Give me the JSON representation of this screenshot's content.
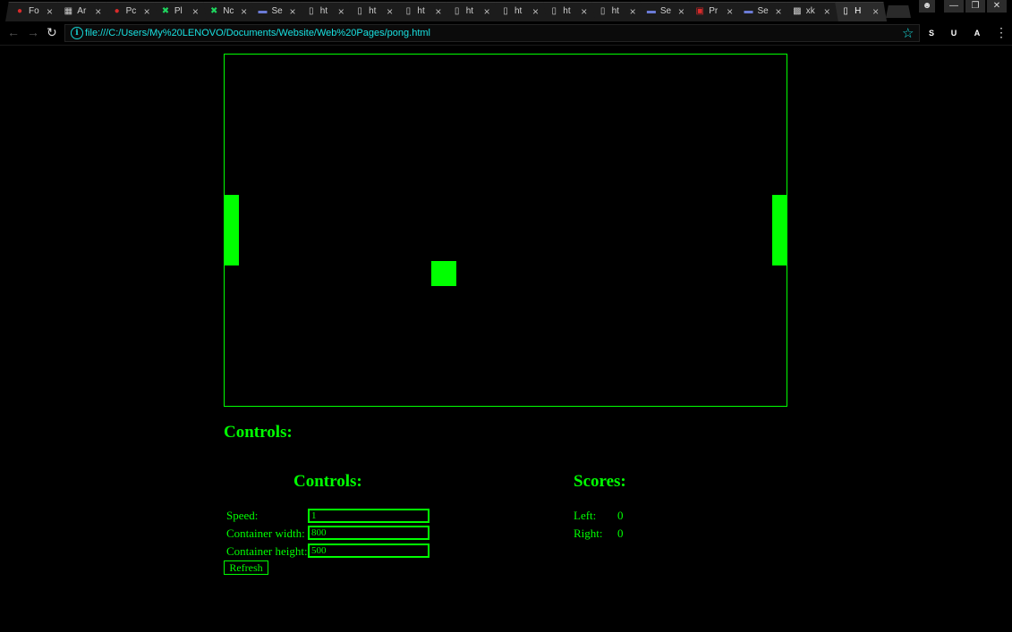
{
  "browser": {
    "tabs": [
      {
        "label": "Fo",
        "icon": "red-cardinal-icon",
        "color": "#d92b2b"
      },
      {
        "label": "Ar",
        "icon": "grid-icon",
        "color": "#cccccc"
      },
      {
        "label": "Pc",
        "icon": "red-cardinal-icon",
        "color": "#d92b2b"
      },
      {
        "label": "Pl",
        "icon": "green-x-icon",
        "color": "#1fd65f"
      },
      {
        "label": "Nc",
        "icon": "green-x-icon",
        "color": "#1fd65f"
      },
      {
        "label": "Se",
        "icon": "monitor-icon",
        "color": "#6b7bd6"
      },
      {
        "label": "ht",
        "icon": "page-icon",
        "color": "#cccccc"
      },
      {
        "label": "ht",
        "icon": "page-icon",
        "color": "#cccccc"
      },
      {
        "label": "ht",
        "icon": "page-icon",
        "color": "#cccccc"
      },
      {
        "label": "ht",
        "icon": "page-icon",
        "color": "#cccccc"
      },
      {
        "label": "ht",
        "icon": "page-icon",
        "color": "#cccccc"
      },
      {
        "label": "ht",
        "icon": "page-icon",
        "color": "#cccccc"
      },
      {
        "label": "ht",
        "icon": "page-icon",
        "color": "#cccccc"
      },
      {
        "label": "Se",
        "icon": "monitor-icon",
        "color": "#6b7bd6"
      },
      {
        "label": "Pr",
        "icon": "pc-icon",
        "color": "#d92b2b"
      },
      {
        "label": "Se",
        "icon": "monitor-icon",
        "color": "#6b7bd6"
      },
      {
        "label": "xk",
        "icon": "pattern-icon",
        "color": "#cccccc"
      },
      {
        "label": "H",
        "icon": "page-icon",
        "color": "#ffffff",
        "active": true
      }
    ],
    "url": "file:///C:/Users/My%20LENOVO/Documents/Website/Web%20Pages/pong.html",
    "extensions": [
      {
        "label": "S",
        "color": "#2a7ad6"
      },
      {
        "label": "U",
        "color": "#c8102e"
      },
      {
        "label": "A",
        "color": "#777777"
      }
    ]
  },
  "colors": {
    "accent": "#00ff00",
    "background": "#000000",
    "url": "#19e0e0"
  },
  "page": {
    "controls_heading_top": "Controls:",
    "controls_heading": "Controls:",
    "scores_heading": "Scores:",
    "speed_label": "Speed:",
    "speed_value": "1",
    "width_label": "Container width:",
    "width_value": "800",
    "height_label": "Container height:",
    "height_value": "500",
    "refresh_label": "Refresh",
    "left_label": "Left:",
    "left_score": "0",
    "right_label": "Right:",
    "right_score": "0"
  }
}
